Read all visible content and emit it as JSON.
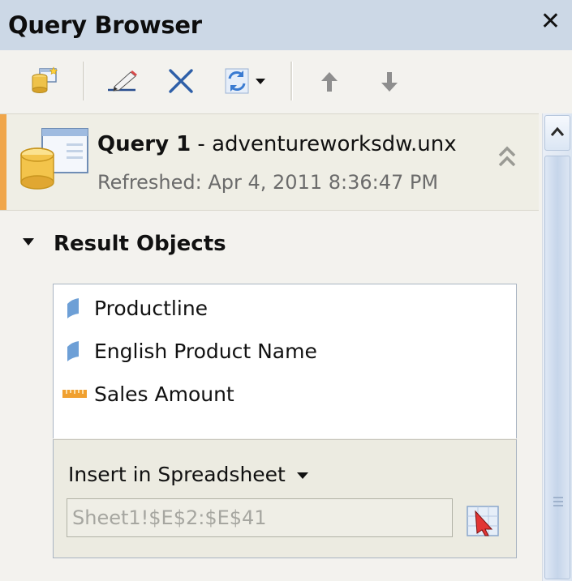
{
  "panel": {
    "title": "Query Browser",
    "close_glyph": "✕"
  },
  "toolbar": {
    "buttons": [
      {
        "name": "add-query",
        "icon": "database-add-icon"
      },
      {
        "name": "edit",
        "icon": "pencil-icon"
      },
      {
        "name": "delete",
        "icon": "delete-x-icon"
      },
      {
        "name": "refresh",
        "icon": "refresh-icon",
        "has_dropdown": true
      },
      {
        "name": "move-up",
        "icon": "arrow-up-icon"
      },
      {
        "name": "move-down",
        "icon": "arrow-down-icon"
      }
    ]
  },
  "query": {
    "name": "Query 1",
    "separator": " - ",
    "source": "adventureworksdw.unx",
    "refreshed": "Refreshed: Apr 4, 2011 8:36:47 PM"
  },
  "result_objects": {
    "header": "Result Objects",
    "items": [
      {
        "label": "Productline",
        "icon": "dimension-icon"
      },
      {
        "label": "English Product Name",
        "icon": "dimension-icon"
      },
      {
        "label": "Sales Amount",
        "icon": "measure-icon"
      }
    ],
    "insert_label": "Insert in Spreadsheet",
    "range_value": "Sheet1!$E$2:$E$41"
  },
  "colors": {
    "title_bar": "#ccd8e6",
    "accent": "#f0a64a",
    "dimension": "#6d9fd6",
    "measure": "#f0a030"
  }
}
